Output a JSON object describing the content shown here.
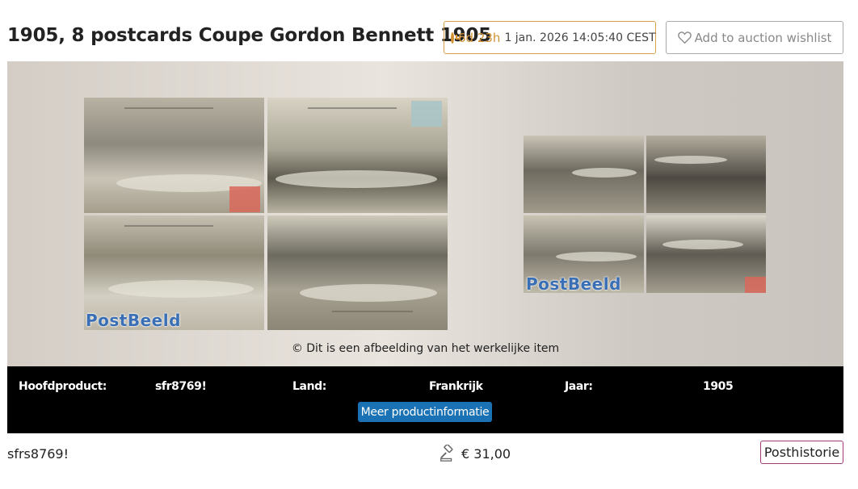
{
  "lot": {
    "title": "1905, 8 postcards Coupe Gordon Bennett 1905",
    "timer": {
      "remaining": "6d 23h",
      "end_date": "1 jan. 2026 14:05:40 CEST",
      "icon": "clock-icon",
      "color": "#d39334"
    },
    "wishlist_label": "Add to auction wishlist",
    "gallery": {
      "watermark": "PostBeeld",
      "copyright": "© Dit is een afbeelding van het werkelijke item"
    },
    "info": {
      "hoofdproduct_label": "Hoofdproduct:",
      "hoofdproduct_value": "sfr8769!",
      "land_label": "Land:",
      "land_value": "Frankrijk",
      "jaar_label": "Jaar:",
      "jaar_value": "1905",
      "more_button": "Meer productinformatie"
    },
    "lot_id": "sfrs8769!",
    "price": "€ 31,00",
    "price_icon": "gavel-icon",
    "category": "Posthistorie",
    "colors": {
      "accent_blue": "#1a72b5",
      "category_border": "#a7397d",
      "timer_border": "#d9a14a"
    }
  }
}
